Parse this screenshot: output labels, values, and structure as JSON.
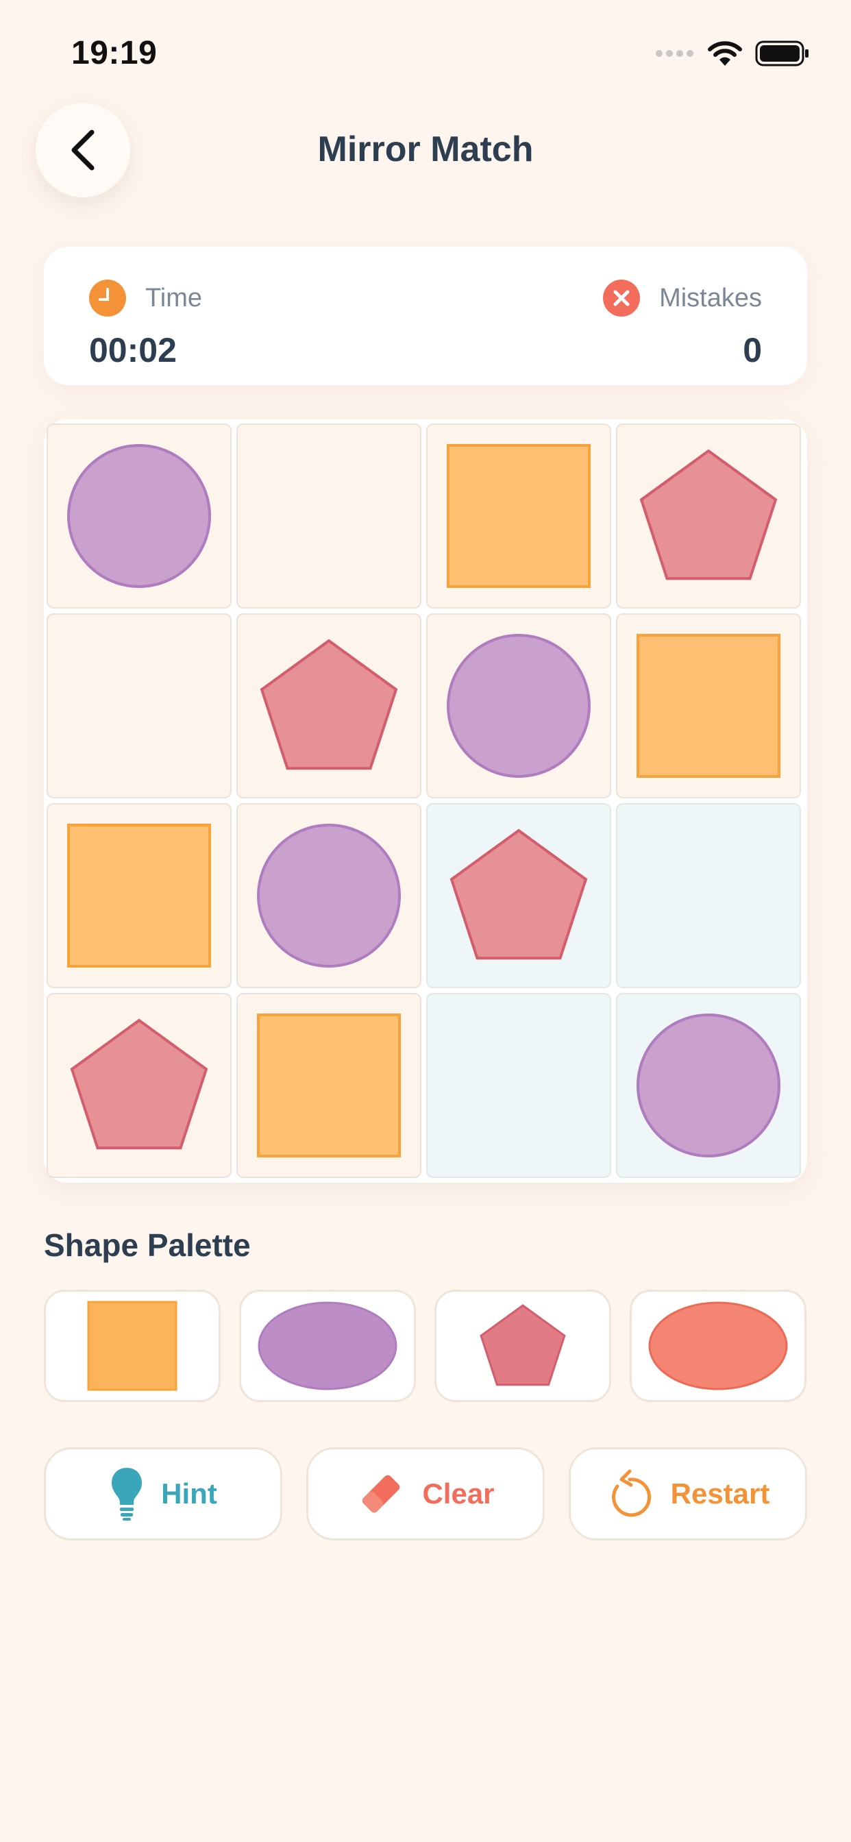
{
  "status_bar": {
    "time": "19:19"
  },
  "header": {
    "title": "Mirror Match"
  },
  "stats": {
    "time_label": "Time",
    "time_value": "00:02",
    "mistakes_label": "Mistakes",
    "mistakes_value": "0"
  },
  "board": {
    "rows": [
      [
        {
          "shape": "circle",
          "bg": "warm"
        },
        {
          "shape": "empty",
          "bg": "warm"
        },
        {
          "shape": "square",
          "bg": "warm"
        },
        {
          "shape": "pentagon",
          "bg": "warm"
        }
      ],
      [
        {
          "shape": "empty",
          "bg": "warm"
        },
        {
          "shape": "pentagon",
          "bg": "warm"
        },
        {
          "shape": "circle",
          "bg": "warm"
        },
        {
          "shape": "square",
          "bg": "warm"
        }
      ],
      [
        {
          "shape": "square",
          "bg": "warm"
        },
        {
          "shape": "circle",
          "bg": "warm"
        },
        {
          "shape": "pentagon",
          "bg": "cool"
        },
        {
          "shape": "empty",
          "bg": "cool"
        }
      ],
      [
        {
          "shape": "pentagon",
          "bg": "warm"
        },
        {
          "shape": "square",
          "bg": "warm"
        },
        {
          "shape": "empty",
          "bg": "cool"
        },
        {
          "shape": "circle",
          "bg": "cool"
        }
      ]
    ]
  },
  "palette": {
    "title": "Shape Palette",
    "items": [
      {
        "shape": "square",
        "color": "orange"
      },
      {
        "shape": "ellipse",
        "color": "purple"
      },
      {
        "shape": "pentagon",
        "color": "red"
      },
      {
        "shape": "ellipse",
        "color": "coral"
      }
    ]
  },
  "actions": {
    "hint_label": "Hint",
    "clear_label": "Clear",
    "restart_label": "Restart"
  },
  "colors": {
    "background": "#fdf5ee",
    "title_text": "#2c3e50",
    "timer_badge": "#f39237",
    "mistakes_badge": "#f26d5b",
    "hint": "#3aa6b9",
    "clear": "#f26d5b",
    "restart": "#f39237",
    "square_fill": "#fdbf72",
    "square_stroke": "#f6a33c",
    "circle_fill": "#c9a1cc",
    "circle_stroke": "#ae7cbf",
    "pentagon_fill": "#e69196",
    "pentagon_stroke": "#d35d6d",
    "palette_orange": "#fcb45b",
    "palette_purple": "#bd8ec6",
    "palette_red": "#e17b86",
    "palette_coral": "#f48572"
  }
}
